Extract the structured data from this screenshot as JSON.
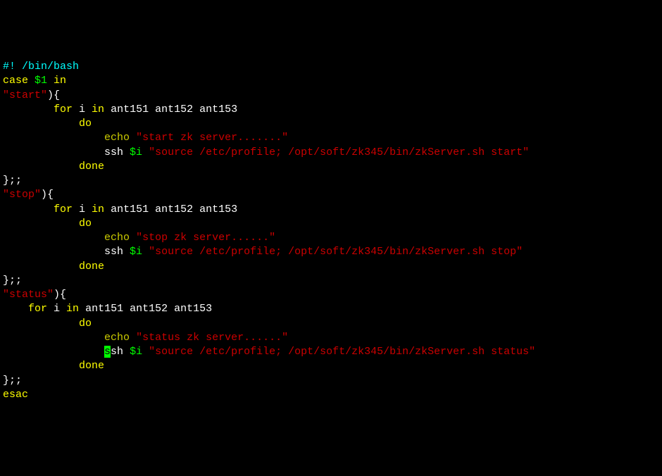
{
  "l0": {
    "a": "#! /bin/bash"
  },
  "l1": {
    "a": "case",
    "b": " $1 ",
    "c": "in"
  },
  "l2": {
    "a": "\"start\"",
    "b": "){"
  },
  "l3": {
    "a": "        ",
    "b": "for",
    "c": " i ",
    "d": "in",
    "e": " ant151 ant152 ant153"
  },
  "l4": {
    "a": "            ",
    "b": "do"
  },
  "l5": {
    "a": "                ",
    "b": "echo",
    "c": " ",
    "d": "\"start zk server.......\""
  },
  "l6": {
    "a": "                ssh ",
    "b": "$i",
    "c": " ",
    "d": "\"source /etc/profile; /opt/soft/zk345/bin/zkServer.sh start\""
  },
  "l7": {
    "a": "            ",
    "b": "done"
  },
  "l8": {
    "a": "};;"
  },
  "l9": {
    "a": "\"stop\"",
    "b": "){"
  },
  "l10": {
    "a": "        ",
    "b": "for",
    "c": " i ",
    "d": "in",
    "e": " ant151 ant152 ant153"
  },
  "l11": {
    "a": "            ",
    "b": "do"
  },
  "l12": {
    "a": "                ",
    "b": "echo",
    "c": " ",
    "d": "\"stop zk server......\""
  },
  "l13": {
    "a": "                ssh ",
    "b": "$i",
    "c": " ",
    "d": "\"source /etc/profile; /opt/soft/zk345/bin/zkServer.sh stop\""
  },
  "l14": {
    "a": "            ",
    "b": "done"
  },
  "l15": {
    "a": "};;"
  },
  "l16": {
    "a": "\"status\"",
    "b": "){"
  },
  "l17": {
    "a": "    ",
    "b": "for",
    "c": " i ",
    "d": "in",
    "e": " ant151 ant152 ant153"
  },
  "l18": {
    "a": "            ",
    "b": "do"
  },
  "l19": {
    "a": "                ",
    "b": "echo",
    "c": " ",
    "d": "\"status zk server......\""
  },
  "l20": {
    "a": "                ",
    "cur": "s",
    "b": "sh ",
    "c": "$i",
    "d": " ",
    "e": "\"source /etc/profile; /opt/soft/zk345/bin/zkServer.sh status\""
  },
  "l21": {
    "a": "            ",
    "b": "done"
  },
  "l22": {
    "a": "};;"
  },
  "l23": {
    "a": "esac"
  }
}
